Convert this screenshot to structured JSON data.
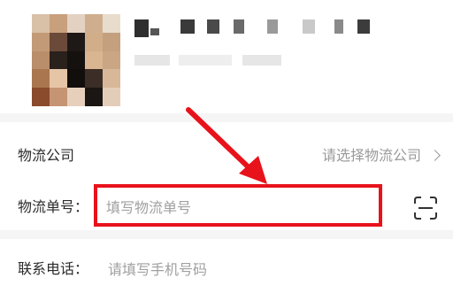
{
  "form": {
    "company_label": "物流公司",
    "company_value": "请选择物流公司",
    "tracking_label": "物流单号：",
    "tracking_placeholder": "填写物流单号"
  },
  "contact": {
    "phone_label": "联系电话：",
    "phone_placeholder": "请填写手机号码"
  },
  "icons": {
    "picker": "chevron-right-icon",
    "scan": "scan-icon",
    "annotation": "red-arrow"
  },
  "colors": {
    "highlight": "#e8121b",
    "placeholder": "#a0a0a0",
    "label": "#2b2b2b"
  }
}
